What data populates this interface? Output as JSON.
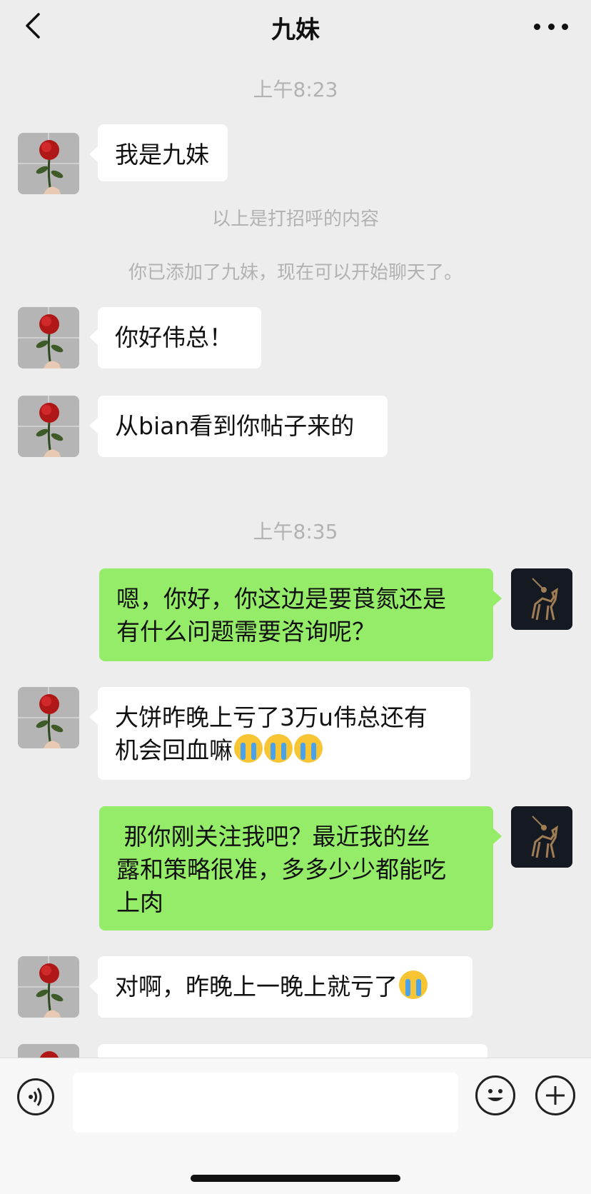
{
  "header": {
    "title": "九妹",
    "back_icon": "chevron-left-icon",
    "more_icon": "more-dots-icon"
  },
  "messages": {
    "t1": "上午8:23",
    "m1": "我是九妹",
    "sys1": "以上是打招呼的内容",
    "sys2": "你已添加了九妹，现在可以开始聊天了。",
    "m2": "你好伟总！",
    "m3": "从bian看到你帖子来的",
    "t2": "上午8:35",
    "m4_line1": "嗯，你好，你这边是要莨氮还是",
    "m4_line2": "有什么问题需要咨询呢？",
    "m5_line1": "大饼昨晚上亏了3万u伟总还有",
    "m5_line2": "机会回血嘛",
    "m6_line1": " 那你刚关注我吧？最近我的丝",
    "m6_line2": "露和策略很准，多多少少都能吃",
    "m6_line3": "上肉",
    "m7": "对啊，昨晚上一晚上就亏了"
  },
  "avatars": {
    "contact": "rose-avatar",
    "self": "polo-horse-avatar"
  },
  "composer": {
    "placeholder": ""
  },
  "colors": {
    "sent_bubble": "#95ec69",
    "received_bubble": "#ffffff",
    "background": "#ededed"
  }
}
